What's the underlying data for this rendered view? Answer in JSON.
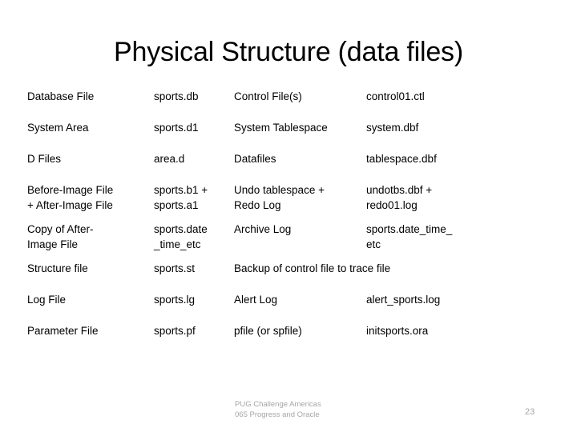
{
  "slide": {
    "title": "Physical Structure (data files)",
    "table": {
      "rows": [
        {
          "c1": [
            "Database File"
          ],
          "c2": [
            "sports.db"
          ],
          "c3": [
            "Control File(s)"
          ],
          "c4": [
            "control01.ctl"
          ]
        },
        {
          "c1": [
            "System Area"
          ],
          "c2": [
            "sports.d1"
          ],
          "c3": [
            "System Tablespace"
          ],
          "c4": [
            "system.dbf"
          ]
        },
        {
          "c1": [
            "D Files"
          ],
          "c2": [
            "area.d"
          ],
          "c3": [
            "Datafiles"
          ],
          "c4": [
            "tablespace.dbf"
          ]
        },
        {
          "c1": [
            "Before-Image File",
            "+ After-Image File"
          ],
          "c2": [
            "sports.b1 +",
            "sports.a1"
          ],
          "c3": [
            "Undo tablespace +",
            "Redo Log"
          ],
          "c4": [
            "undotbs.dbf +",
            "redo01.log"
          ]
        },
        {
          "c1": [
            "Copy of After-",
            "Image File"
          ],
          "c2": [
            "sports.date",
            "_time_etc"
          ],
          "c3": [
            "Archive Log"
          ],
          "c4": [
            "sports.date_time_",
            "etc"
          ]
        },
        {
          "c1": [
            "Structure file"
          ],
          "c2": [
            "sports.st"
          ],
          "c3": [
            "Backup of control file to trace file"
          ],
          "c4": null,
          "span34": true
        },
        {
          "c1": [
            "Log File"
          ],
          "c2": [
            "sports.lg"
          ],
          "c3": [
            "Alert Log"
          ],
          "c4": [
            "alert_sports.log"
          ]
        },
        {
          "c1": [
            "Parameter File"
          ],
          "c2": [
            "sports.pf"
          ],
          "c3": [
            "pfile (or spfile)"
          ],
          "c4": [
            "initsports.ora"
          ]
        }
      ]
    },
    "footer": {
      "line1": "PUG Challenge Americas",
      "line2": "065 Progress and Oracle"
    },
    "page_number": "23"
  }
}
